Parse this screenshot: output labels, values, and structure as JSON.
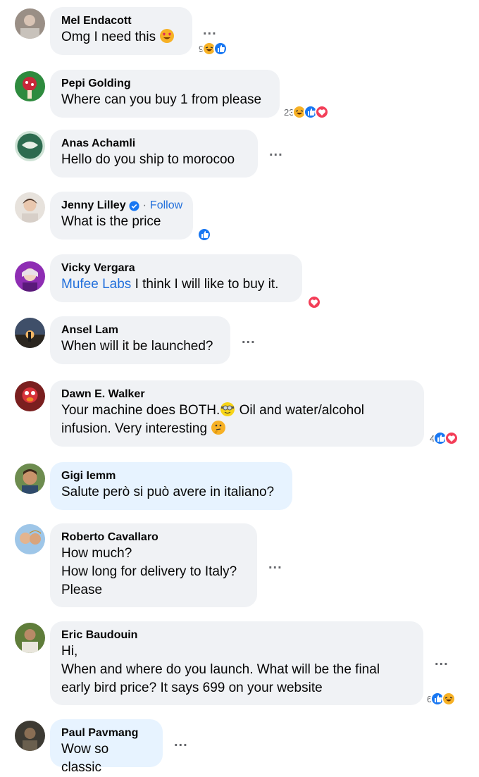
{
  "comments": [
    {
      "name": "Mel Endacott",
      "lines": [
        "Omg I need this"
      ],
      "reaction_count": "9"
    },
    {
      "name": "Pepi Golding",
      "lines": [
        "Where can you buy 1 from please"
      ],
      "reaction_count": "23"
    },
    {
      "name": "Anas Achamli",
      "lines": [
        "Hello do you ship to morocoo"
      ]
    },
    {
      "name": "Jenny Lilley",
      "follow": "Follow",
      "lines": [
        "What is the price"
      ]
    },
    {
      "name": "Vicky Vergara",
      "mention": "Mufee Labs",
      "lines": [
        " I think I will like to buy it."
      ]
    },
    {
      "name": "Ansel Lam",
      "lines": [
        "When will it be launched?"
      ]
    },
    {
      "name": "Dawn E. Walker",
      "lines": [
        "Your machine does BOTH.",
        " Oil and water/alcohol",
        "infusion. Very interesting"
      ],
      "reaction_count": "4"
    },
    {
      "name": "Gigi Iemm",
      "lines": [
        "Salute però si può avere in italiano?"
      ]
    },
    {
      "name": "Roberto Cavallaro",
      "lines": [
        "How much?",
        "How long for delivery to Italy?",
        "Please"
      ]
    },
    {
      "name": "Eric Baudouin",
      "lines": [
        "Hi,",
        "When and where do you launch. What will be the final",
        "early bird price? It says 699 on your website"
      ],
      "reaction_count": "6"
    },
    {
      "name": "Paul Pavmang",
      "lines": [
        "Wow so classic"
      ]
    }
  ],
  "more_options_label": "...",
  "name_separator": "·",
  "colors": {
    "bubble": "#f0f2f5",
    "bubble_highlight": "#e7f3ff",
    "link": "#216fdb",
    "like": "#1877f2",
    "love": "#f33e58",
    "haha": "#f7b125"
  }
}
